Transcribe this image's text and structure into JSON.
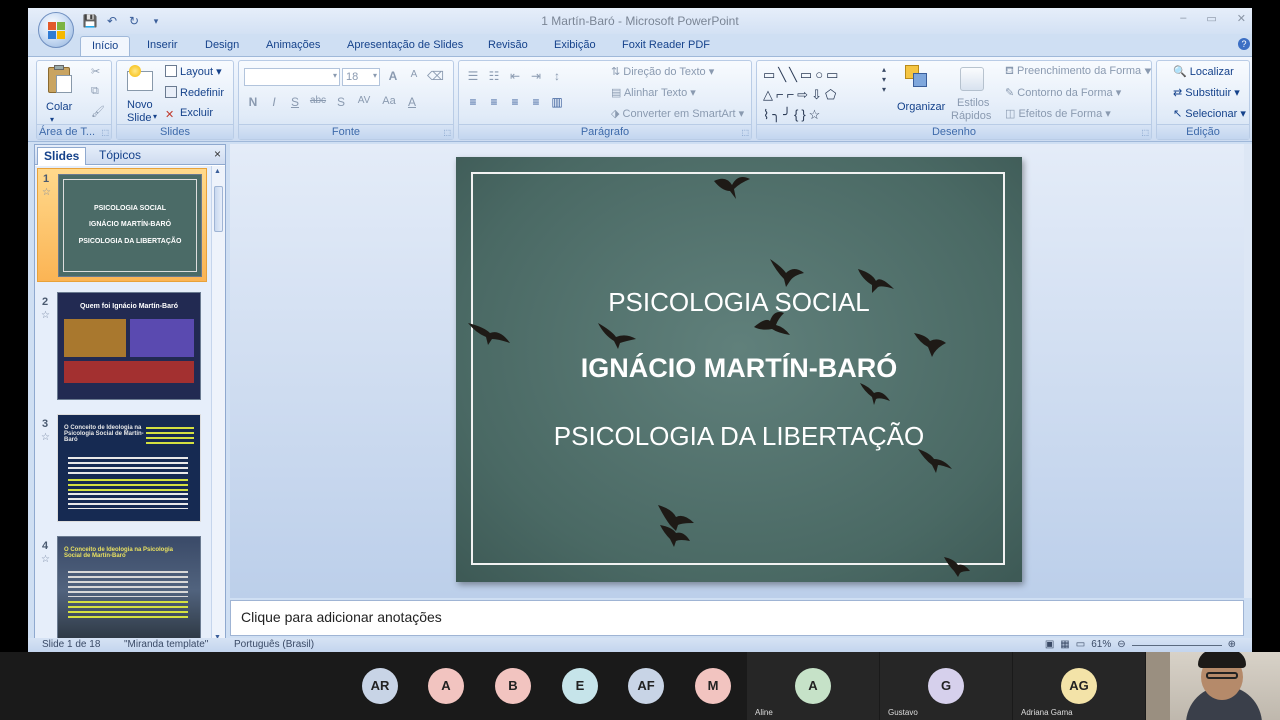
{
  "window": {
    "title": "1 Martín-Baró - Microsoft PowerPoint",
    "min": "–",
    "max": "▭",
    "close": "✕"
  },
  "ribbon_tabs": [
    "Início",
    "Inserir",
    "Design",
    "Animações",
    "Apresentação de Slides",
    "Revisão",
    "Exibição",
    "Foxit Reader PDF"
  ],
  "ribbon": {
    "clipboard": {
      "paste": "Colar",
      "label": "Área de T..."
    },
    "slides": {
      "new_slide": "Novo\nSlide",
      "new_slide_1": "Novo",
      "new_slide_2": "Slide",
      "layout": "Layout",
      "reset": "Redefinir",
      "delete": "Excluir",
      "label": "Slides"
    },
    "font": {
      "size": "18",
      "label": "Fonte",
      "bold": "N",
      "italic": "I",
      "underline": "S",
      "strike": "abc",
      "shadow": "S",
      "spacing": "AV",
      "case": "Aa",
      "color": "A",
      "grow": "A",
      "shrink": "A"
    },
    "paragraph": {
      "text_direction": "Direção do Texto",
      "align_text": "Alinhar Texto",
      "smartart": "Converter em SmartArt",
      "label": "Parágrafo"
    },
    "drawing": {
      "arrange": "Organizar",
      "quick_styles_1": "Estilos",
      "quick_styles_2": "Rápidos",
      "fill": "Preenchimento da Forma",
      "outline": "Contorno da Forma",
      "effects": "Efeitos de Forma",
      "label": "Desenho"
    },
    "editing": {
      "find": "Localizar",
      "replace": "Substituir",
      "select": "Selecionar",
      "label": "Edição"
    }
  },
  "left_pane": {
    "tab_slides": "Slides",
    "tab_outline": "Tópicos",
    "close": "×",
    "thumbnails": [
      {
        "num": "1",
        "lines": [
          "PSICOLOGIA SOCIAL",
          "IGNÁCIO MARTÍN-BARÓ",
          "PSICOLOGIA DA LIBERTAÇÃO"
        ]
      },
      {
        "num": "2",
        "title": "Quem foi Ignácio Martín-Baró"
      },
      {
        "num": "3",
        "title": "O Conceito de Ideologia na Psicologia Social de Martín-Baró"
      },
      {
        "num": "4",
        "title": "O Conceito de Ideologia na Psicologia Social de Martín-Baró"
      }
    ]
  },
  "slide": {
    "line1": "PSICOLOGIA SOCIAL",
    "line2": "IGNÁCIO MARTÍN-BARÓ",
    "line3": "PSICOLOGIA DA LIBERTAÇÃO"
  },
  "notes_placeholder": "Clique para adicionar anotações",
  "status": {
    "slide_pos": "Slide 1 de 18",
    "template": "\"Miranda template\"",
    "language": "Português (Brasil)",
    "zoom": "61%"
  },
  "meeting": {
    "avatars": [
      {
        "initials": "AR",
        "color": "#c8d4e6"
      },
      {
        "initials": "A",
        "color": "#f2c4c0"
      },
      {
        "initials": "B",
        "color": "#f2c4c0"
      },
      {
        "initials": "E",
        "color": "#c6e4ea"
      },
      {
        "initials": "AF",
        "color": "#c8d4e6"
      },
      {
        "initials": "M",
        "color": "#f2c4c0"
      }
    ],
    "tiles": [
      {
        "initials": "A",
        "name": "Aline",
        "color": "#c6e2c8"
      },
      {
        "initials": "G",
        "name": "Gustavo",
        "color": "#d6d0ec"
      },
      {
        "initials": "AG",
        "name": "Adriana Gama",
        "color": "#f3e3a8"
      }
    ]
  }
}
